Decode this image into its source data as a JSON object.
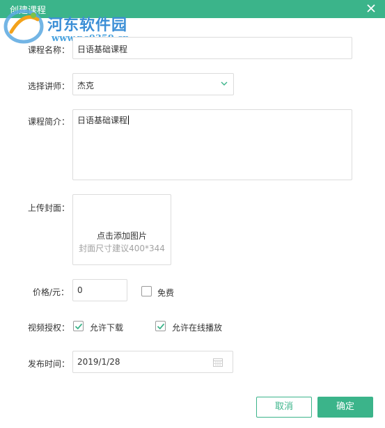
{
  "dialog": {
    "title": "创建课程",
    "close_icon": "close-icon",
    "accent_color": "#3bb48a"
  },
  "watermark": {
    "name": "河东软件园",
    "url": "www.pc0359.cn"
  },
  "form": {
    "course_name": {
      "label": "课程名称：",
      "value": "日语基础课程"
    },
    "lecturer": {
      "label": "选择讲师：",
      "value": "杰克",
      "icon": "chevron-down-icon"
    },
    "intro": {
      "label": "课程简介：",
      "value": "日语基础课程"
    },
    "cover": {
      "label": "上传封面：",
      "action": "点击添加图片",
      "hint": "封面尺寸建议400*344"
    },
    "price": {
      "label": "价格/元：",
      "value": "0",
      "free_label": "免费",
      "free_checked": false
    },
    "video_auth": {
      "label": "视频授权：",
      "allow_download": {
        "label": "允许下载",
        "checked": true
      },
      "allow_online": {
        "label": "允许在线播放",
        "checked": true
      }
    },
    "publish_time": {
      "label": "发布时间：",
      "value": "2019/1/28",
      "icon": "calendar-icon"
    }
  },
  "buttons": {
    "cancel": "取消",
    "confirm": "确定"
  }
}
